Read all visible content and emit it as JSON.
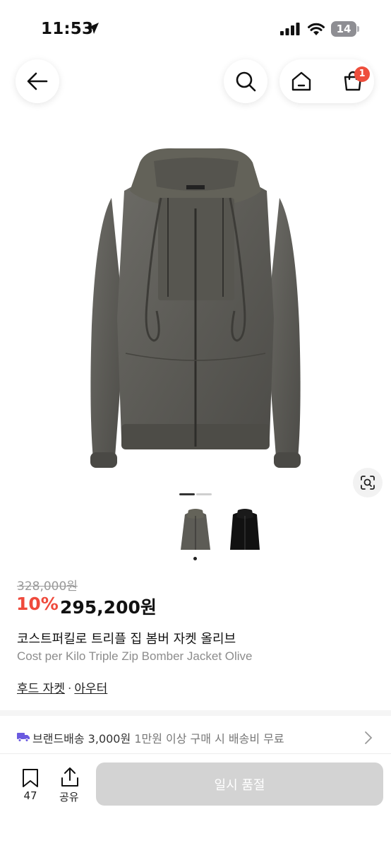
{
  "status_bar": {
    "time": "11:53",
    "battery": "14"
  },
  "nav": {
    "cart_count": "1"
  },
  "product": {
    "original_price": "328,000원",
    "discount_rate": "10%",
    "sale_price": "295,200원",
    "name_ko": "코스트퍼킬로 트리플 집 봄버 자켓 올리브",
    "name_en": "Cost per Kilo Triple Zip Bomber Jacket Olive",
    "categories": [
      "후드 자켓",
      "아우터"
    ],
    "category_separator": "·"
  },
  "shipping": {
    "label": "브랜드배송 3,000원",
    "note": "1만원 이상 구매 시 배송비 무료"
  },
  "bottom_bar": {
    "bookmark_count": "47",
    "share_label": "공유",
    "buy_button_label": "일시 품절"
  },
  "icons": {
    "back": "arrow-left-icon",
    "search": "search-icon",
    "home": "home-icon",
    "cart": "shopping-bag-icon",
    "lens": "image-search-icon",
    "bookmark": "bookmark-icon",
    "share": "share-icon",
    "truck": "truck-icon",
    "chevron": "chevron-right-icon"
  },
  "colors": {
    "discount": "#ef4a3c",
    "badge": "#ee4e3c",
    "truck": "#6a5ae0",
    "disabled_button": "#d3d3d3"
  },
  "carousel": {
    "current_index": 1,
    "total": 2
  }
}
